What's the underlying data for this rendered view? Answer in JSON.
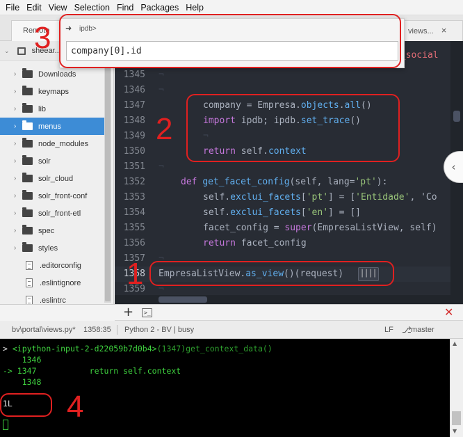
{
  "menu": [
    "File",
    "Edit",
    "View",
    "Selection",
    "Find",
    "Packages",
    "Help"
  ],
  "tabs": {
    "left": "Remote",
    "right": "views...",
    "right_close": "×"
  },
  "sidebar": {
    "root": "sheear...",
    "items": [
      {
        "label": "Downloads",
        "type": "folder"
      },
      {
        "label": "keymaps",
        "type": "folder"
      },
      {
        "label": "lib",
        "type": "folder"
      },
      {
        "label": "menus",
        "type": "folder",
        "selected": true
      },
      {
        "label": "node_modules",
        "type": "folder"
      },
      {
        "label": "solr",
        "type": "folder"
      },
      {
        "label": "solr_cloud",
        "type": "folder"
      },
      {
        "label": "solr_front-conf",
        "type": "folder"
      },
      {
        "label": "solr_front-etl",
        "type": "folder"
      },
      {
        "label": "spec",
        "type": "folder"
      },
      {
        "label": "styles",
        "type": "folder"
      },
      {
        "label": ".editorconfig",
        "type": "file"
      },
      {
        "label": ".eslintignore",
        "type": "file"
      },
      {
        "label": ".eslintrc",
        "type": "file"
      }
    ]
  },
  "palette": {
    "title": "ipdb>",
    "input_value": "company[0].id"
  },
  "editor": {
    "behind_palette_text": "o_social",
    "lines": [
      {
        "n": "1345",
        "text": ""
      },
      {
        "n": "1346",
        "text": ""
      },
      {
        "n": "1347",
        "text": "company = Empresa.objects.all()"
      },
      {
        "n": "1348",
        "text": "import ipdb; ipdb.set_trace()"
      },
      {
        "n": "1349",
        "text": ""
      },
      {
        "n": "1350",
        "text": "return self.context"
      },
      {
        "n": "1351",
        "text": ""
      },
      {
        "n": "1352",
        "text": "def get_facet_config(self, lang='pt'):"
      },
      {
        "n": "1353",
        "text": "self.exclui_facets['pt'] = ['Entidade', 'Co"
      },
      {
        "n": "1354",
        "text": "self.exclui_facets['en'] = []"
      },
      {
        "n": "1355",
        "text": "facet_config = super(EmpresaListView, self)"
      },
      {
        "n": "1356",
        "text": "return facet_config"
      },
      {
        "n": "1357",
        "text": ""
      },
      {
        "n": "1358",
        "text": "EmpresaListView.as_view()(request)"
      },
      {
        "n": "1359",
        "text": ""
      }
    ],
    "mini_button": "││││"
  },
  "terminal_toolbar": {
    "add": "+",
    "terminal_icon": ">_",
    "close": "✕"
  },
  "statusbar": {
    "path": "bv\\portal\\views.py*",
    "position": "1358:35",
    "interpreter": "Python 2 - BV | busy",
    "line_ending": "LF",
    "branch_icon": "⎇",
    "branch": "master"
  },
  "terminal": {
    "prompt": ">",
    "header": "<ipython-input-2-d22059b7d0b4>",
    "header_suffix": "(1347)get_context_data()",
    "l1_num": "1346",
    "arrow": "->",
    "l2_num": "1347",
    "l2_code": "return self.context",
    "l3_num": "1348",
    "output": "1L"
  },
  "annotations": [
    "1",
    "2",
    "3",
    "4"
  ],
  "colors": {
    "annotation": "#e02020",
    "selected": "#3d8cd6",
    "editor_bg": "#282c34",
    "terminal_green": "#3fd23f"
  }
}
